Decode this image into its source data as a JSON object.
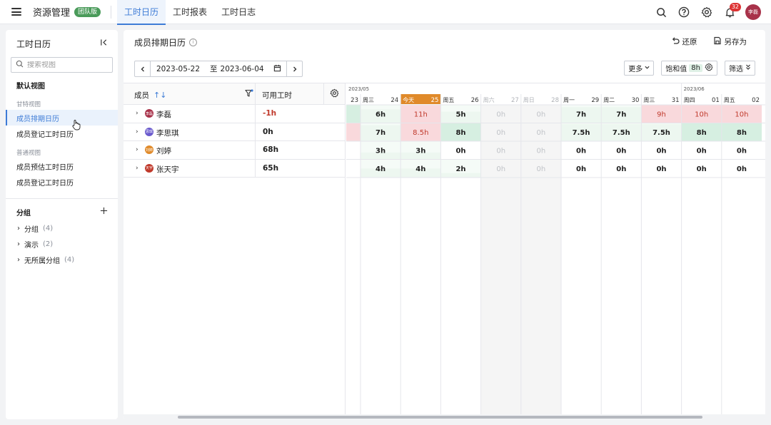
{
  "topbar": {
    "app_title": "资源管理",
    "team_badge": "团队版",
    "tabs": [
      {
        "label": "工时日历",
        "active": true
      },
      {
        "label": "工时报表",
        "active": false
      },
      {
        "label": "工时日志",
        "active": false
      }
    ],
    "notification_count": "32",
    "user_avatar": "李磊",
    "icons": [
      "search-icon",
      "help-icon",
      "settings-icon",
      "bell-icon"
    ]
  },
  "sidebar": {
    "title": "工时日历",
    "search_placeholder": "搜索视图",
    "default_view": "默认视图",
    "gantt_caption": "甘特视图",
    "gantt_items": [
      {
        "label": "成员排期日历",
        "active": true
      },
      {
        "label": "成员登记工时日历",
        "active": false
      }
    ],
    "normal_caption": "普通视图",
    "normal_items": [
      {
        "label": "成员预估工时日历"
      },
      {
        "label": "成员登记工时日历"
      }
    ],
    "groups_title": "分组",
    "groups": [
      {
        "label": "分组",
        "count": "(4)"
      },
      {
        "label": "演示",
        "count": "(2)"
      },
      {
        "label": "无所属分组",
        "count": "(4)"
      }
    ]
  },
  "main": {
    "title": "成员排期日历",
    "restore": "还原",
    "save_as": "另存为",
    "date_start": "2023-05-22",
    "date_to": "至",
    "date_end": "2023-06-04",
    "more": "更多",
    "saturation_label": "饱和值",
    "saturation_value": "8h",
    "filter": "筛选",
    "col_member": "成员",
    "col_available": "可用工时"
  },
  "members": [
    {
      "name": "李磊",
      "avatar": "李磊",
      "avatar_color": "#a8324a",
      "available": "-1h",
      "negative": true
    },
    {
      "name": "李思琪",
      "avatar": "思琪",
      "avatar_color": "#6a5acd",
      "available": "0h",
      "negative": false
    },
    {
      "name": "刘婷",
      "avatar": "刘婷",
      "avatar_color": "#e08a2a",
      "available": "68h",
      "negative": false
    },
    {
      "name": "张天宇",
      "avatar": "天宇",
      "avatar_color": "#c0392b",
      "available": "65h",
      "negative": false
    }
  ],
  "calendar": {
    "month_may": "2023/05",
    "month_june": "2023/06",
    "days": [
      {
        "wd": "",
        "d": "23",
        "type": "partial"
      },
      {
        "wd": "周三",
        "d": "24",
        "type": "work"
      },
      {
        "wd": "今天",
        "d": "25",
        "type": "today"
      },
      {
        "wd": "周五",
        "d": "26",
        "type": "work"
      },
      {
        "wd": "周六",
        "d": "27",
        "type": "weekend"
      },
      {
        "wd": "周日",
        "d": "28",
        "type": "weekend"
      },
      {
        "wd": "周一",
        "d": "29",
        "type": "work"
      },
      {
        "wd": "周二",
        "d": "30",
        "type": "work"
      },
      {
        "wd": "周三",
        "d": "31",
        "type": "work"
      },
      {
        "wd": "周四",
        "d": "01",
        "type": "work"
      },
      {
        "wd": "周五",
        "d": "02",
        "type": "work"
      }
    ],
    "hours": [
      [
        "",
        "6h",
        "11h",
        "5h",
        "0h",
        "0h",
        "7h",
        "7h",
        "9h",
        "10h",
        "10h"
      ],
      [
        "",
        "7h",
        "8.5h",
        "8h",
        "0h",
        "0h",
        "7.5h",
        "7.5h",
        "7.5h",
        "8h",
        "8h"
      ],
      [
        "",
        "3h",
        "3h",
        "0h",
        "0h",
        "0h",
        "0h",
        "0h",
        "0h",
        "0h",
        "0h"
      ],
      [
        "",
        "4h",
        "4h",
        "2h",
        "0h",
        "0h",
        "0h",
        "0h",
        "0h",
        "0h",
        "0h"
      ]
    ],
    "colors": {
      "over": "#f9d9dc",
      "over_text": "#c0392b",
      "under": "#edf7f0",
      "full": "#d6efe1",
      "weekend": "#f5f5f5",
      "today": "#e08a2a"
    }
  }
}
